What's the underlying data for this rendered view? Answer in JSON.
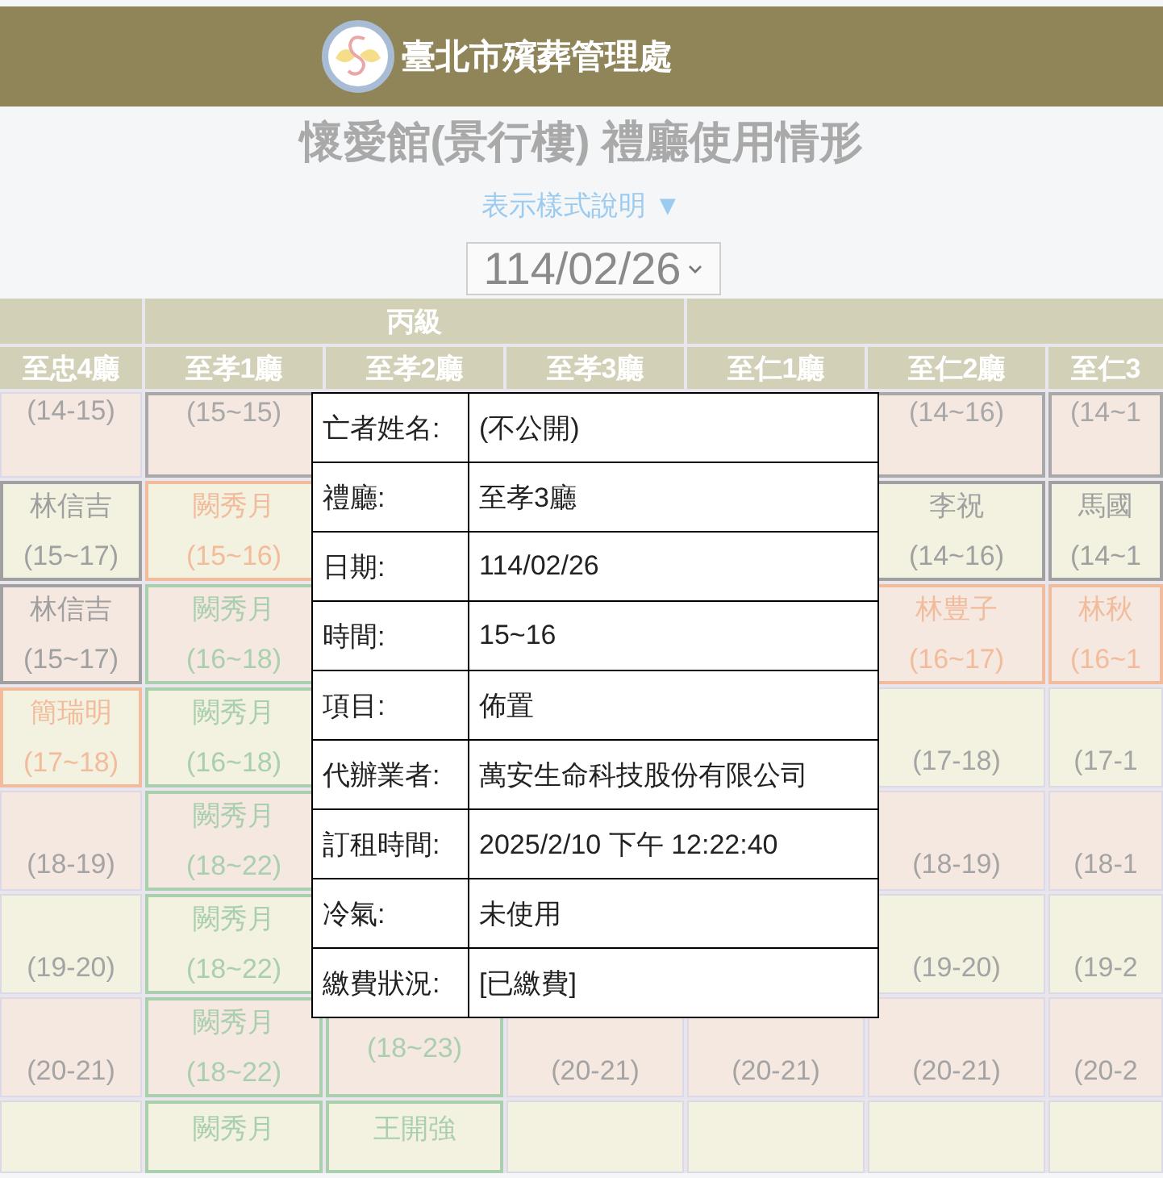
{
  "header": {
    "title": "臺北市殯葬管理處"
  },
  "page_title": "懷愛館(景行樓) 禮廳使用情形",
  "legend_link": "表示樣式說明 ▼",
  "date_select": {
    "value": "114/02/26"
  },
  "table": {
    "group_label": "丙級",
    "columns": [
      "至忠4廳",
      "至孝1廳",
      "至孝2廳",
      "至孝3廳",
      "至仁1廳",
      "至仁2廳",
      "至仁3"
    ],
    "rows": [
      [
        {
          "kind": "free",
          "time": "(14-15)"
        },
        {
          "kind": "booked",
          "time": "(15~15)",
          "color": "#a8a8a8"
        },
        null,
        null,
        null,
        {
          "kind": "booked",
          "time": "(14~16)",
          "color": "#a8a8a8"
        },
        {
          "kind": "booked",
          "time": "(14~1",
          "color": "#a8a8a8"
        }
      ],
      [
        {
          "kind": "booked",
          "name": "林信吉",
          "time": "(15~17)",
          "color": "#a0a0a0"
        },
        {
          "kind": "booked",
          "name": "闕秀月",
          "time": "(15~16)",
          "color": "#f2bc9c"
        },
        null,
        null,
        null,
        {
          "kind": "booked",
          "name": "李祝",
          "time": "(14~16)",
          "color": "#a0a0a0"
        },
        {
          "kind": "booked",
          "name": "馬國",
          "time": "(14~1",
          "color": "#a0a0a0"
        }
      ],
      [
        {
          "kind": "booked",
          "name": "林信吉",
          "time": "(15~17)",
          "color": "#a0a0a0"
        },
        {
          "kind": "booked",
          "name": "闕秀月",
          "time": "(16~18)",
          "color": "#a9cfae"
        },
        null,
        null,
        null,
        {
          "kind": "booked",
          "name": "林豊子",
          "time": "(16~17)",
          "color": "#f2bc9c"
        },
        {
          "kind": "booked",
          "name": "林秋",
          "time": "(16~1",
          "color": "#f2bc9c"
        }
      ],
      [
        {
          "kind": "booked",
          "name": "簡瑞明",
          "time": "(17~18)",
          "color": "#f2bc9c"
        },
        {
          "kind": "booked",
          "name": "闕秀月",
          "time": "(16~18)",
          "color": "#a9cfae"
        },
        null,
        null,
        null,
        {
          "kind": "free",
          "time": "(17-18)"
        },
        {
          "kind": "free",
          "time": "(17-1"
        }
      ],
      [
        {
          "kind": "free",
          "time": "(18-19)"
        },
        {
          "kind": "booked",
          "name": "闕秀月",
          "time": "(18~22)",
          "color": "#a9cfae"
        },
        null,
        null,
        null,
        {
          "kind": "free",
          "time": "(18-19)"
        },
        {
          "kind": "free",
          "time": "(18-1"
        }
      ],
      [
        {
          "kind": "free",
          "time": "(19-20)"
        },
        {
          "kind": "booked",
          "name": "闕秀月",
          "time": "(18~22)",
          "color": "#a9cfae"
        },
        null,
        null,
        null,
        {
          "kind": "free",
          "time": "(19-20)"
        },
        {
          "kind": "free",
          "time": "(19-2"
        }
      ],
      [
        {
          "kind": "free",
          "time": "(20-21)"
        },
        {
          "kind": "booked",
          "name": "闕秀月",
          "time": "(18~22)",
          "color": "#a9cfae"
        },
        {
          "kind": "booked",
          "time": "(18~23)",
          "color": "#a9cfae"
        },
        {
          "kind": "free",
          "time": "(20-21)"
        },
        {
          "kind": "free",
          "time": "(20-21)"
        },
        {
          "kind": "free",
          "time": "(20-21)"
        },
        {
          "kind": "free",
          "time": "(20-2"
        }
      ],
      [
        null,
        {
          "kind": "booked",
          "name": "闕秀月",
          "color": "#a9cfae"
        },
        {
          "kind": "booked",
          "name": "王開強",
          "color": "#a9cfae"
        },
        null,
        null,
        null,
        null
      ]
    ]
  },
  "popup": {
    "fields": [
      {
        "label": "亡者姓名:",
        "value": "(不公開)"
      },
      {
        "label": "禮廳:",
        "value": "至孝3廳"
      },
      {
        "label": "日期:",
        "value": "114/02/26"
      },
      {
        "label": "時間:",
        "value": "15~16"
      },
      {
        "label": "項目:",
        "value": "佈置"
      },
      {
        "label": "代辦業者:",
        "value": "萬安生命科技股份有限公司"
      },
      {
        "label": "訂租時間:",
        "value": "2025/2/10 下午 12:22:40"
      },
      {
        "label": "冷氣:",
        "value": "未使用"
      },
      {
        "label": "繳費狀況:",
        "value": "[已繳費]"
      }
    ]
  }
}
